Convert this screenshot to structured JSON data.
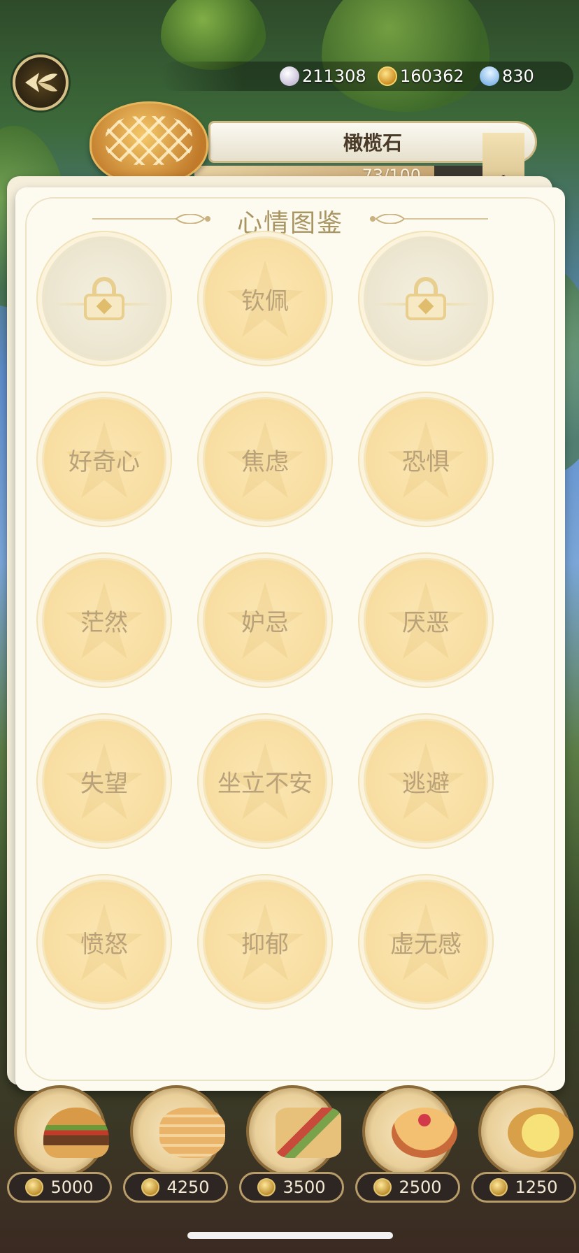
{
  "currencies": [
    {
      "name": "shell",
      "icon": "shell-icon",
      "value": "211308"
    },
    {
      "name": "coin",
      "icon": "coin-icon",
      "value": "160362"
    },
    {
      "name": "gem",
      "icon": "gem-icon",
      "value": "830"
    }
  ],
  "character": {
    "name": "橄榄石",
    "progress_text": "73/100",
    "progress_value": 73,
    "progress_max": 100
  },
  "panel": {
    "title": "心情图鉴"
  },
  "moods": [
    {
      "label": "",
      "locked": true
    },
    {
      "label": "钦佩",
      "locked": false
    },
    {
      "label": "",
      "locked": true
    },
    {
      "label": "好奇心",
      "locked": false
    },
    {
      "label": "焦虑",
      "locked": false
    },
    {
      "label": "恐惧",
      "locked": false
    },
    {
      "label": "茫然",
      "locked": false
    },
    {
      "label": "妒忌",
      "locked": false
    },
    {
      "label": "厌恶",
      "locked": false
    },
    {
      "label": "失望",
      "locked": false
    },
    {
      "label": "坐立不安",
      "locked": false
    },
    {
      "label": "逃避",
      "locked": false
    },
    {
      "label": "愤怒",
      "locked": false
    },
    {
      "label": "抑郁",
      "locked": false
    },
    {
      "label": "虚无感",
      "locked": false
    }
  ],
  "foods": [
    {
      "name": "burger",
      "icon": "burger-icon",
      "price": "5000"
    },
    {
      "name": "pancake-stack",
      "icon": "pancake-icon",
      "price": "4250"
    },
    {
      "name": "sandwich",
      "icon": "sandwich-icon",
      "price": "3500"
    },
    {
      "name": "berry-pudding",
      "icon": "pudding-icon",
      "price": "2500"
    },
    {
      "name": "tart",
      "icon": "tart-icon",
      "price": "1250"
    }
  ],
  "colors": {
    "panel_bg": "#fdfaf0",
    "title": "#a99562",
    "mood_fill": "#f8dea2",
    "mood_text": "#b9a27a",
    "price_bg": "#2e2622"
  }
}
